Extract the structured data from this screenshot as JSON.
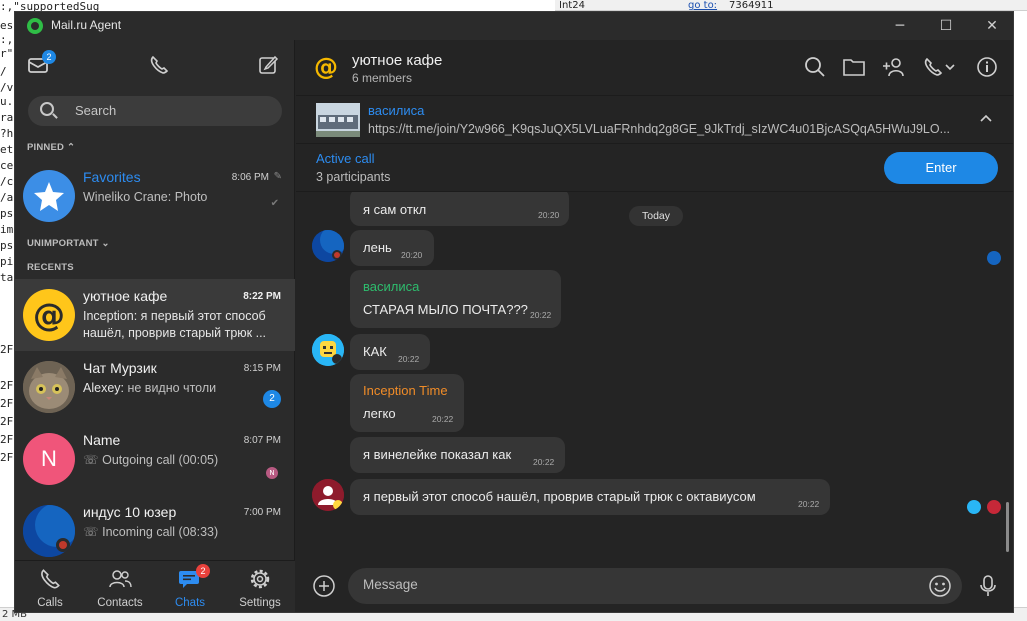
{
  "background": {
    "code_lines": [
      ":,\"supportedSug",
      "es",
      ":,",
      "r\"",
      "/",
      "/v",
      "u.",
      "ra",
      "d",
      "?h",
      "et",
      "ce",
      "/c",
      "/a",
      "ps",
      "im",
      "ps",
      "pi",
      "ta"
    ],
    "side_markers": [
      "2F",
      "2F",
      "2F",
      "2F",
      "2F",
      "2F"
    ],
    "top_right": {
      "field": "Int24",
      "goto_label": "go to:",
      "goto_value": "7364911"
    },
    "bottom_left": "2 MB"
  },
  "window": {
    "title": "Mail.ru Agent",
    "buttons": {
      "minimize": "─",
      "maximize": "☐",
      "close": "✕"
    }
  },
  "sidebar": {
    "mail_badge": "2",
    "search_placeholder": "Search",
    "sections": {
      "pinned": "PINNED",
      "unimportant": "UNIMPORTANT",
      "recents": "RECENTS"
    },
    "favorites": {
      "name": "Favorites",
      "time": "8:06 PM",
      "preview": "Wineliko Crane: Photo"
    },
    "chats": [
      {
        "name": "уютное кафе",
        "time": "8:22 PM",
        "preview_line1": "Inception: я первый этот способ",
        "preview_line2": "нашёл, проврив старый трюк ..."
      },
      {
        "name": "Чат Мурзик",
        "time": "8:15 PM",
        "preview_sender": "Alexey:",
        "preview_text": "не видно чтоли",
        "unread": "2"
      },
      {
        "name": "Name",
        "time": "8:07 PM",
        "preview_text": "Outgoing call (00:05)",
        "avatar_letter": "N",
        "mini_avatar_letter": "N"
      },
      {
        "name": "индус 10 юзер",
        "time": "7:00 PM",
        "preview_text": "Incoming call (08:33)"
      }
    ],
    "tabs": [
      {
        "label": "Calls",
        "icon": "phone-icon"
      },
      {
        "label": "Contacts",
        "icon": "contacts-icon"
      },
      {
        "label": "Chats",
        "icon": "chats-icon",
        "badge": "2"
      },
      {
        "label": "Settings",
        "icon": "gear-icon"
      }
    ]
  },
  "chat": {
    "title": "уютное кафе",
    "members": "6 members",
    "pinned": {
      "sender": "василиса",
      "link": "https://tt.me/join/Y2w966_K9qsJuQX5LVLuaFRnhdq2g8GE_9JkTrdj_sIzWC4u01BjcASQqA5HWuJ9LO..."
    },
    "active_call": {
      "title": "Active call",
      "participants": "3 participants",
      "button": "Enter"
    },
    "today_label": "Today",
    "messages": [
      {
        "text": "я сам откл",
        "time": "20:20"
      },
      {
        "text": "лень",
        "time": "20:20"
      },
      {
        "sender": "василиса",
        "text": "СТАРАЯ МЫЛО ПОЧТА???",
        "time": "20:22"
      },
      {
        "text": "КАК",
        "time": "20:22"
      },
      {
        "sender": "Inception Time",
        "text": "легко",
        "time": "20:22"
      },
      {
        "text": "я винелейке показал как",
        "time": "20:22"
      },
      {
        "text": "я первый этот способ нашёл, проврив старый трюк с октавиусом",
        "time": "20:22"
      }
    ],
    "composer_placeholder": "Message"
  },
  "colors": {
    "accent": "#1e88e5",
    "link": "#2d8cf0",
    "sender_green": "#2ebd6e",
    "sender_orange": "#f08c28",
    "at_yellow": "#f5b800"
  }
}
